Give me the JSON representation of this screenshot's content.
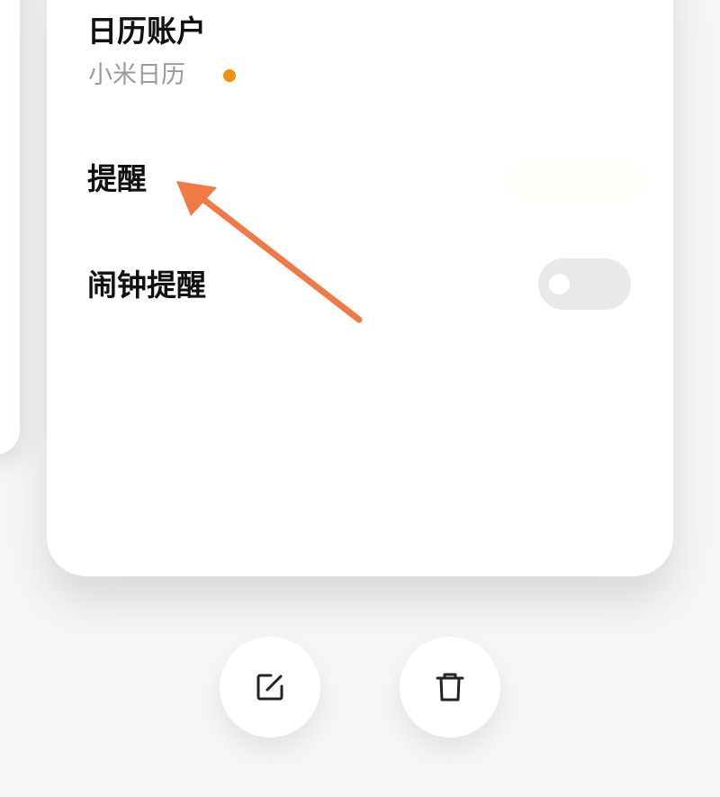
{
  "account": {
    "title": "日历账户",
    "value": "小米日历",
    "status_dot_color": "#f0900f"
  },
  "reminder": {
    "title": "提醒"
  },
  "alarm_reminder": {
    "title": "闹钟提醒",
    "toggle_on": false
  },
  "annotation": {
    "arrow_color": "#f07a46"
  },
  "actions": {
    "edit_icon": "edit-icon",
    "delete_icon": "trash-icon"
  }
}
